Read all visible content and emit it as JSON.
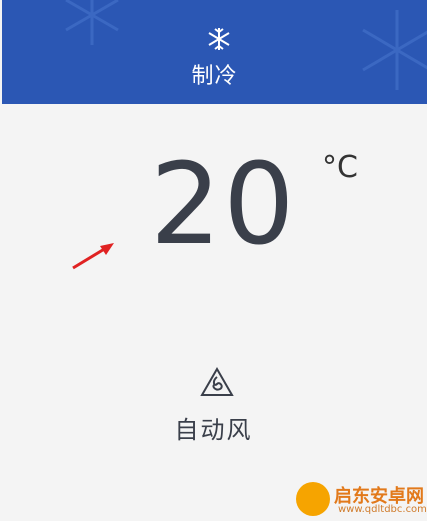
{
  "header": {
    "mode_label": "制冷",
    "mode_icon": "snowflake-icon",
    "bg": "#2b57b4"
  },
  "temperature": {
    "value": "20",
    "unit": "°C"
  },
  "fan": {
    "label": "自动风",
    "icon": "fan-icon"
  },
  "watermark": {
    "name": "启东安卓网",
    "url": "www.qdltdbc.com"
  }
}
